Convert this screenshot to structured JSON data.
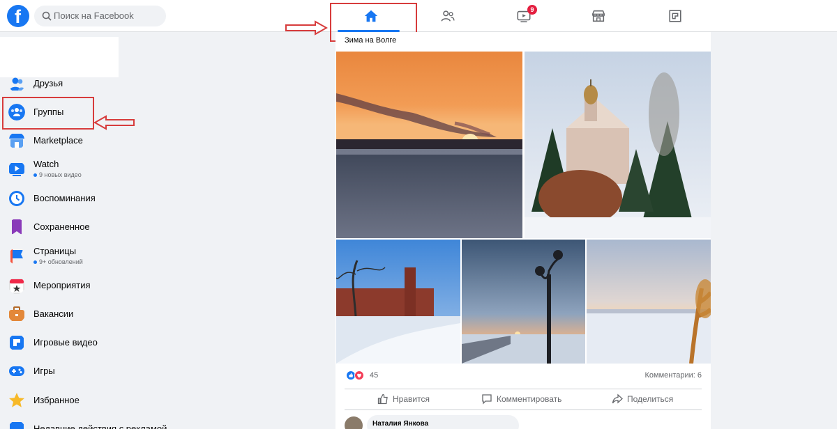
{
  "header": {
    "logo_letter": "f",
    "search_placeholder": "Поиск на Facebook",
    "watch_badge": "9"
  },
  "sidebar": {
    "items": [
      {
        "label": "Друзья",
        "icon": "friends-icon"
      },
      {
        "label": "Группы",
        "icon": "groups-icon"
      },
      {
        "label": "Marketplace",
        "icon": "marketplace-icon"
      },
      {
        "label": "Watch",
        "icon": "watch-icon",
        "sub": "9 новых видео"
      },
      {
        "label": "Воспоминания",
        "icon": "memories-icon"
      },
      {
        "label": "Сохраненное",
        "icon": "saved-icon"
      },
      {
        "label": "Страницы",
        "icon": "pages-icon",
        "sub": "9+ обновлений"
      },
      {
        "label": "Мероприятия",
        "icon": "events-icon"
      },
      {
        "label": "Вакансии",
        "icon": "jobs-icon"
      },
      {
        "label": "Игровые видео",
        "icon": "gaming-video-icon"
      },
      {
        "label": "Игры",
        "icon": "games-icon"
      },
      {
        "label": "Избранное",
        "icon": "favorites-icon"
      },
      {
        "label": "Недавние действия с рекламой",
        "icon": "ad-activity-icon"
      }
    ]
  },
  "post": {
    "text": "Зима на Волге",
    "reaction_count": "45",
    "comments": "Комментарии: 6",
    "like_label": "Нравится",
    "comment_label": "Комментировать",
    "share_label": "Поделиться",
    "commenter_name": "Наталия Янкова"
  },
  "colors": {
    "brand": "#1877f2",
    "annotation": "#d73c3c",
    "badge": "#e41e3f"
  }
}
